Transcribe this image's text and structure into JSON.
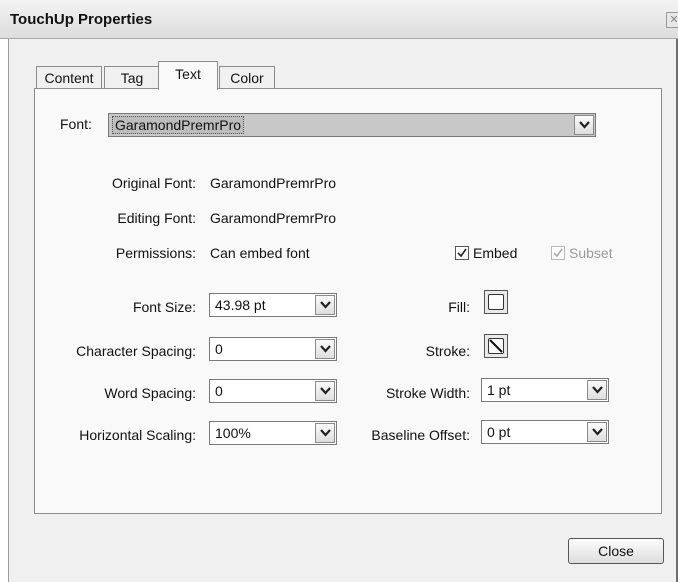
{
  "window": {
    "title": "TouchUp Properties"
  },
  "tabs": [
    {
      "label": "Content"
    },
    {
      "label": "Tag"
    },
    {
      "label": "Text"
    },
    {
      "label": "Color"
    }
  ],
  "active_tab": "Text",
  "font": {
    "label": "Font:",
    "value": "GaramondPremrPro"
  },
  "info": {
    "original_font_label": "Original Font:",
    "original_font_value": "GaramondPremrPro",
    "editing_font_label": "Editing Font:",
    "editing_font_value": "GaramondPremrPro",
    "permissions_label": "Permissions:",
    "permissions_value": "Can embed font"
  },
  "embed": {
    "label": "Embed",
    "checked": true,
    "enabled": true
  },
  "subset": {
    "label": "Subset",
    "checked": true,
    "enabled": false
  },
  "fields": {
    "font_size": {
      "label": "Font Size:",
      "value": "43.98 pt"
    },
    "character_spacing": {
      "label": "Character Spacing:",
      "value": "0"
    },
    "word_spacing": {
      "label": "Word Spacing:",
      "value": "0"
    },
    "horizontal_scaling": {
      "label": "Horizontal Scaling:",
      "value": "100%"
    },
    "fill": {
      "label": "Fill:"
    },
    "stroke": {
      "label": "Stroke:"
    },
    "stroke_width": {
      "label": "Stroke Width:",
      "value": "1 pt"
    },
    "baseline_offset": {
      "label": "Baseline Offset:",
      "value": "0 pt"
    }
  },
  "buttons": {
    "close": "Close"
  },
  "icons": {
    "dropdown": "chevron-down-icon",
    "check": "check-icon",
    "fill_swatch": "fill-swatch-icon",
    "stroke_swatch": "no-stroke-icon",
    "window_close": "close-icon"
  },
  "colors": {
    "panel_bg": "#f9f9f9",
    "window_bg": "#f0f0f0",
    "font_field_bg": "#c8c8c8"
  }
}
